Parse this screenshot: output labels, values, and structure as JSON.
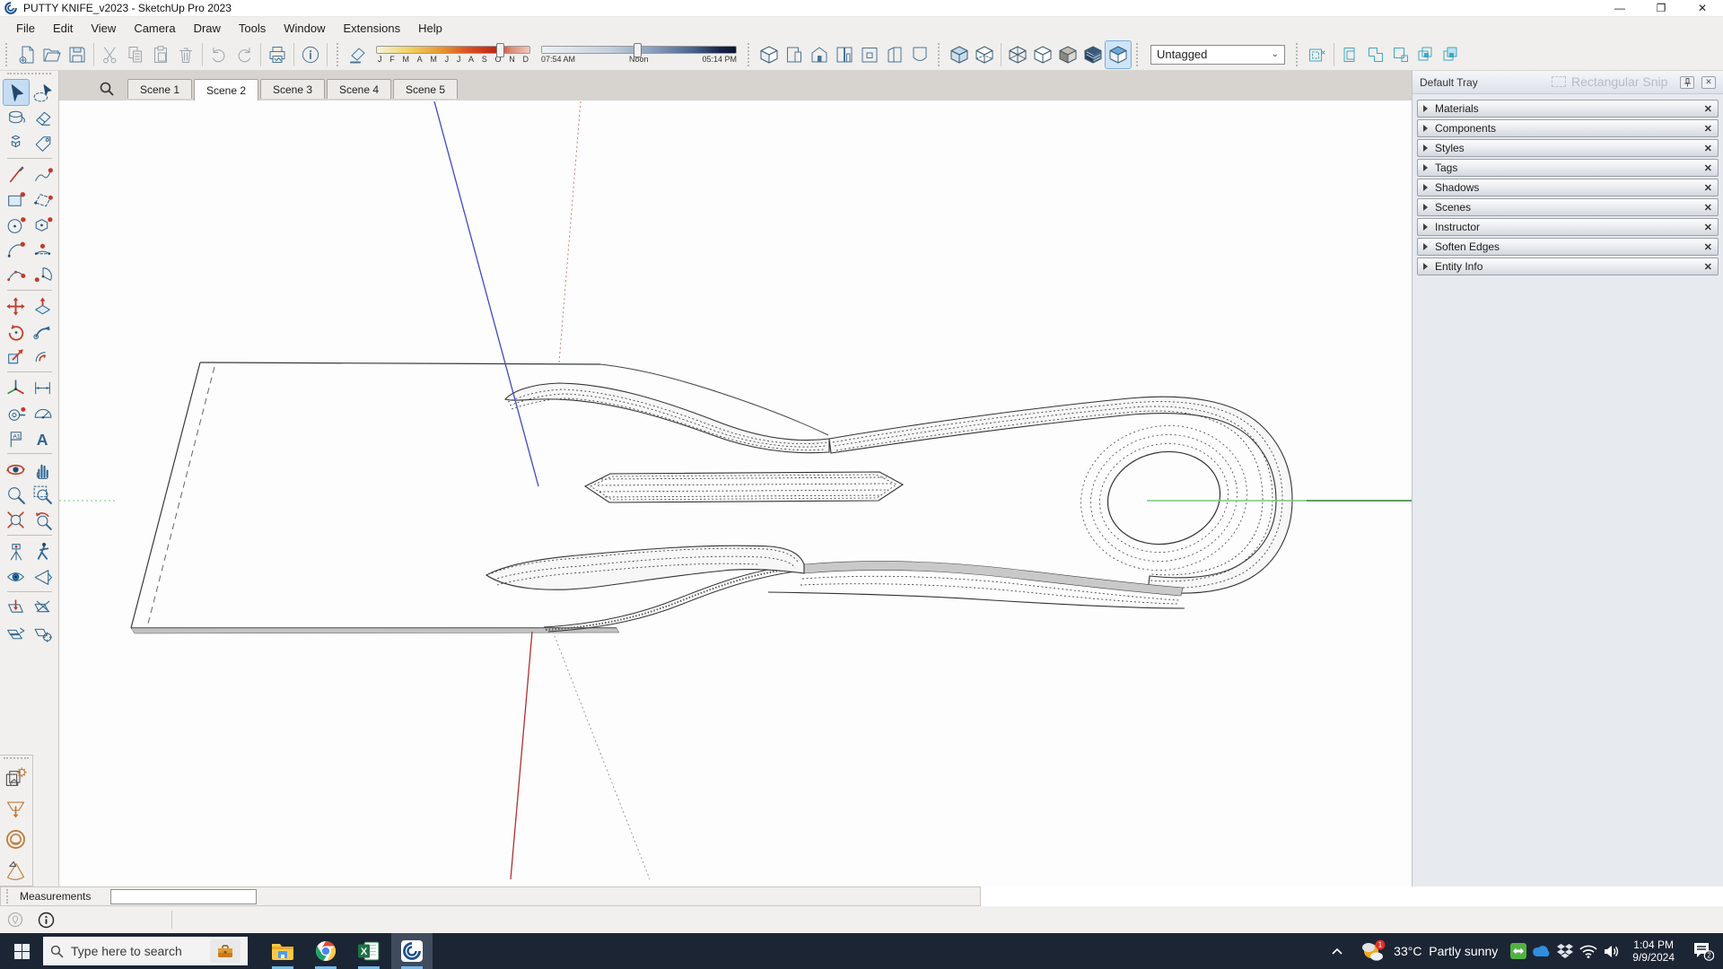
{
  "window": {
    "title": "PUTTY KNIFE_v2023 - SketchUp Pro 2023",
    "controls": {
      "minimize": "—",
      "restore": "❐",
      "close": "✕"
    }
  },
  "menu": {
    "items": [
      "File",
      "Edit",
      "View",
      "Camera",
      "Draw",
      "Tools",
      "Window",
      "Extensions",
      "Help"
    ]
  },
  "toolbar": {
    "standard": [
      {
        "name": "new",
        "disabled": false
      },
      {
        "name": "open",
        "disabled": false
      },
      {
        "name": "save",
        "disabled": false
      },
      {
        "name": "cut",
        "disabled": true
      },
      {
        "name": "copy",
        "disabled": true
      },
      {
        "name": "paste",
        "disabled": true
      },
      {
        "name": "erase",
        "disabled": true
      },
      {
        "name": "undo",
        "disabled": true
      },
      {
        "name": "redo",
        "disabled": true
      },
      {
        "name": "print",
        "disabled": false
      },
      {
        "name": "model-info",
        "disabled": false
      }
    ],
    "shadows": {
      "toggle_icon": "shadows-toggle",
      "months": [
        "J",
        "F",
        "M",
        "A",
        "M",
        "J",
        "J",
        "A",
        "S",
        "O",
        "N",
        "D"
      ],
      "date_handle_pct": 78,
      "time_labels": [
        "07:54 AM",
        "Noon",
        "05:14 PM"
      ],
      "time_handle_pct": 47
    },
    "views": [
      "iso",
      "top",
      "front",
      "right",
      "back",
      "left",
      "bottom"
    ],
    "styles": [
      "x-ray",
      "back-edges",
      "wireframe",
      "hidden-line",
      "shaded",
      "shaded-with-textures",
      "monochrome"
    ],
    "styles_active_index": 6,
    "tag_dropdown": {
      "value": "Untagged"
    },
    "extra": [
      "select-similar",
      "make-group",
      "edit-group",
      "move-to-layer",
      "paste-in-place",
      "swap-components"
    ]
  },
  "scene_tabs": {
    "tabs": [
      "Scene 1",
      "Scene 2",
      "Scene 3",
      "Scene 4",
      "Scene 5"
    ],
    "active_index": 1
  },
  "palette": {
    "rows": [
      [
        "select",
        "lasso-select"
      ],
      [
        "paint-bucket",
        "eraser"
      ],
      [
        "make-component",
        "tag"
      ],
      [
        "line",
        "freehand"
      ],
      [
        "rectangle",
        "rotated-rectangle"
      ],
      [
        "circle",
        "polygon"
      ],
      [
        "arc",
        "two-point-arc"
      ],
      [
        "three-point-arc",
        "pie"
      ],
      [
        "move",
        "push-pull"
      ],
      [
        "rotate",
        "follow-me"
      ],
      [
        "scale",
        "offset"
      ],
      [
        "axes",
        "dimensions"
      ],
      [
        "tape-measure",
        "protractor"
      ],
      [
        "text",
        "3d-text"
      ],
      [
        "orbit",
        "pan"
      ],
      [
        "zoom",
        "zoom-window"
      ],
      [
        "zoom-extents",
        "zoom-previous"
      ],
      [
        "position-camera",
        "walk"
      ],
      [
        "look-around",
        "section-view"
      ],
      [
        "section-plane",
        "display-section-cuts"
      ],
      [
        "display-section-planes",
        "section-fill"
      ]
    ],
    "dividers_after_rows": [
      3,
      8,
      11,
      14,
      17,
      19
    ],
    "selected_tool": "select",
    "secondary": [
      "shadow-scenes",
      "funnel-tool",
      "pipe-tool",
      "cone-tool",
      "ellipse-tool"
    ]
  },
  "tray": {
    "title": "Default Tray",
    "sections": [
      "Materials",
      "Components",
      "Styles",
      "Tags",
      "Shadows",
      "Scenes",
      "Instructor",
      "Soften Edges",
      "Entity Info"
    ],
    "overlay_text": "Rectangular Snip"
  },
  "measurements": {
    "label": "Measurements",
    "value": ""
  },
  "taskbar": {
    "search_placeholder": "Type here to search",
    "apps": [
      "file-explorer",
      "chrome",
      "excel",
      "sketchup"
    ],
    "active_app": "sketchup",
    "weather": {
      "temp": "33°C",
      "condition": "Partly sunny",
      "badge": "1"
    },
    "clock": {
      "time": "1:04 PM",
      "date": "9/9/2024"
    },
    "notification_badge": "2"
  },
  "colors": {
    "accent_blue": "#2f6591",
    "icon_steel": "#4a7397",
    "icon_gray": "#9aa3ab",
    "icon_red": "#c33b2c",
    "taskbar": "#1c2534",
    "highlight": "#cfe4f7",
    "axis_green": "#3c9e3c",
    "axis_blue": "#3f49c4",
    "axis_red": "#b03030"
  }
}
